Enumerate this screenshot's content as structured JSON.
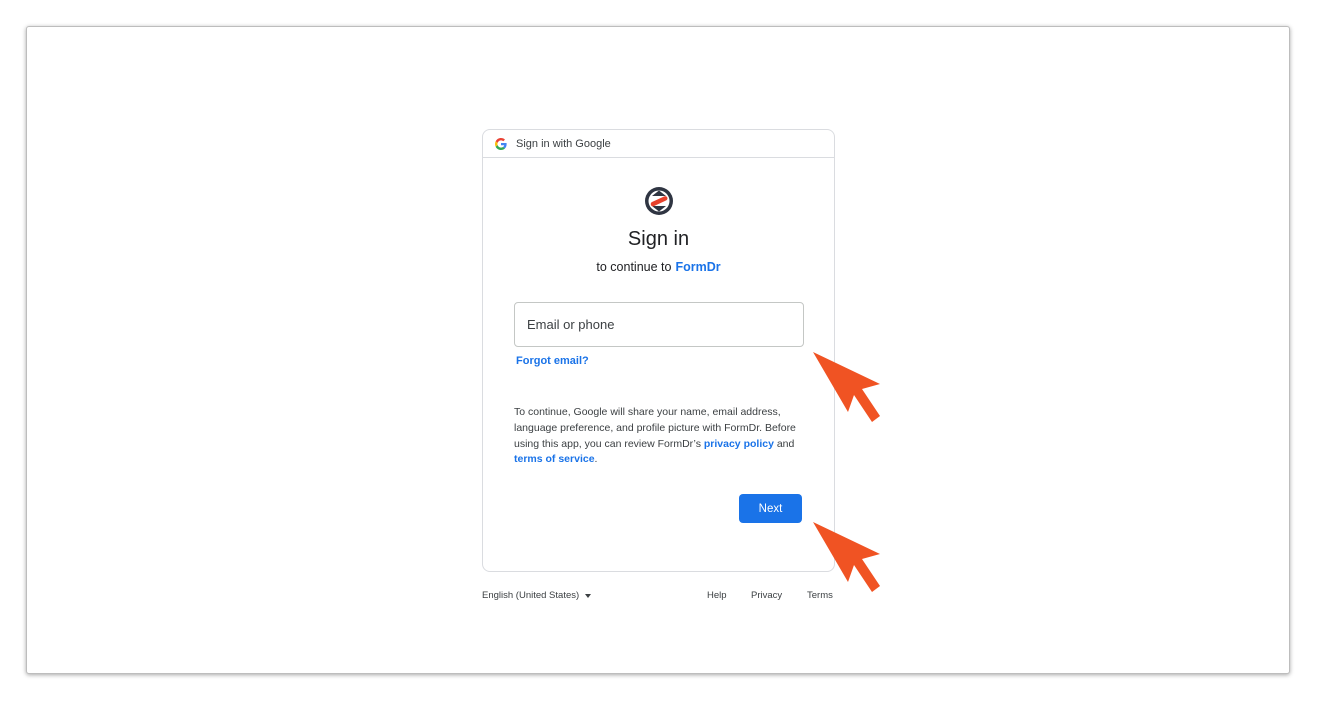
{
  "header": {
    "title": "Sign in with Google",
    "icon": "google-g-icon"
  },
  "main": {
    "logo_icon": "formdr-logo-icon",
    "title": "Sign in",
    "subtitle_prefix": "to continue to",
    "app_name": "FormDr"
  },
  "email": {
    "placeholder": "Email or phone",
    "value": ""
  },
  "forgot_email": "Forgot email?",
  "consent": {
    "text": "To continue, Google will share your name, email address, language preference, and profile picture with FormDr. Before using this app, you can review FormDr’s",
    "privacy_link": "privacy policy",
    "and": "and",
    "terms_link": "terms of service",
    "period": "."
  },
  "next_label": "Next",
  "footer": {
    "language": "English (United States)",
    "help": "Help",
    "privacy": "Privacy",
    "terms": "Terms"
  },
  "colors": {
    "accent": "#1a73e8",
    "annotation_arrow": "#f05323"
  }
}
